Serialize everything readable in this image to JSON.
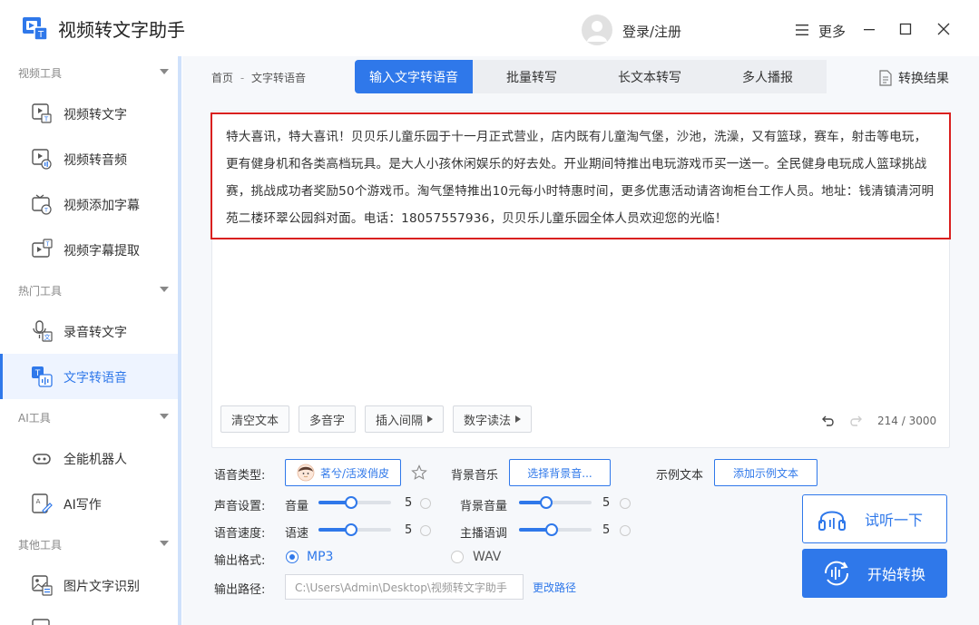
{
  "window": {
    "title": "视频转文字助手",
    "login_label": "登录/注册",
    "more_label": "更多"
  },
  "sidebar": {
    "groups": [
      {
        "label": "视频工具"
      },
      {
        "label": "热门工具"
      },
      {
        "label": "AI工具"
      },
      {
        "label": "其他工具"
      }
    ],
    "items": [
      {
        "label": "视频转文字",
        "icon": "video-to-text-icon"
      },
      {
        "label": "视频转音频",
        "icon": "video-to-audio-icon"
      },
      {
        "label": "视频添加字幕",
        "icon": "video-add-subtitle-icon"
      },
      {
        "label": "视频字幕提取",
        "icon": "video-subtitle-extract-icon"
      },
      {
        "label": "录音转文字",
        "icon": "recording-to-text-icon"
      },
      {
        "label": "文字转语音",
        "icon": "text-to-speech-icon",
        "active": true
      },
      {
        "label": "全能机器人",
        "icon": "robot-icon"
      },
      {
        "label": "AI写作",
        "icon": "ai-writing-icon"
      },
      {
        "label": "图片文字识别",
        "icon": "image-ocr-icon"
      }
    ]
  },
  "breadcrumb": {
    "home": "首页",
    "separator": "-",
    "current": "文字转语音"
  },
  "tabs": [
    {
      "label": "输入文字转语音",
      "active": true
    },
    {
      "label": "批量转写"
    },
    {
      "label": "长文本转写"
    },
    {
      "label": "多人播报"
    }
  ],
  "result_label": "转换结果",
  "editor": {
    "text": "特大喜讯，特大喜讯！贝贝乐儿童乐园于十一月正式营业，店内既有儿童淘气堡，沙池，洗澡，又有篮球，赛车，射击等电玩，更有健身机和各类高档玩具。是大人小孩休闲娱乐的好去处。开业期间特推出电玩游戏币买一送一。全民健身电玩成人篮球挑战赛，挑战成功者奖励50个游戏币。淘气堡特推出10元每小时特惠时间，更多优惠活动请咨询柜台工作人员。地址：钱清镇清河明苑二楼环翠公园斜对面。电话：18057557936，贝贝乐儿童乐园全体人员欢迎您的光临！",
    "tools": {
      "clear": "清空文本",
      "polyphone": "多音字",
      "insert_pause": "插入间隔",
      "number_reading": "数字读法"
    },
    "char_count": "214 / 3000"
  },
  "settings": {
    "voice_type_label": "语音类型:",
    "voice_name": "茗兮/活泼俏皮",
    "bg_music_label": "背景音乐",
    "bg_music_button": "选择背景音...",
    "sample_text_label": "示例文本",
    "sample_text_button": "添加示例文本",
    "sound_label": "声音设置:",
    "volume_label": "音量",
    "volume_value": "5",
    "volume_fraction": 0.45,
    "bg_volume_label": "背景音量",
    "bg_volume_value": "5",
    "bg_volume_fraction": 0.38,
    "speed_row_label": "语音速度:",
    "speed_label": "语速",
    "speed_value": "5",
    "speed_fraction": 0.45,
    "pitch_label": "主播语调",
    "pitch_value": "5",
    "pitch_fraction": 0.45,
    "format_label": "输出格式:",
    "format_mp3": "MP3",
    "format_wav": "WAV",
    "selected_format": "MP3",
    "path_label": "输出路径:",
    "path_value": "C:\\Users\\Admin\\Desktop\\视频转文字助手",
    "change_path": "更改路径"
  },
  "actions": {
    "preview": "试听一下",
    "start": "开始转换"
  },
  "colors": {
    "accent": "#2f78ea",
    "highlight_border": "#d9201f"
  }
}
